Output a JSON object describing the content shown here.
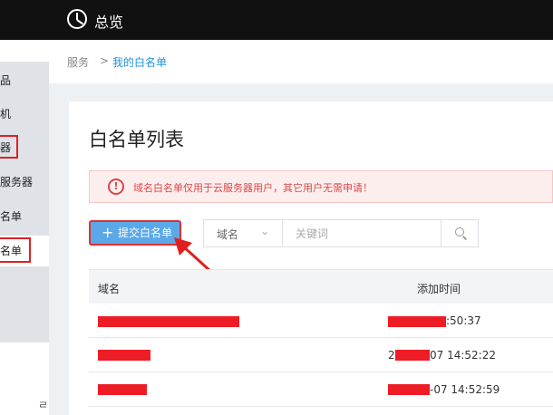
{
  "header": {
    "title": "总览",
    "logo_icon": "dashboard-icon"
  },
  "sidebar": {
    "items": [
      {
        "label": "品",
        "active": false
      },
      {
        "label": "机",
        "active": false
      },
      {
        "label": "器",
        "active": false
      },
      {
        "label": "服务器",
        "active": false
      },
      {
        "label": "名单",
        "active": false
      },
      {
        "label": "名单",
        "active": true
      }
    ],
    "bottom_label": "ㄹ"
  },
  "breadcrumb": {
    "parent": "服务",
    "separator": ">",
    "current": "我的白名单"
  },
  "page": {
    "title": "白名单列表",
    "alert": {
      "icon": "info-icon",
      "text": "域名白名单仅用于云服务器用户，其它用户无需申请！"
    },
    "submit_button": {
      "icon": "plus-icon",
      "label": "提交白名单"
    },
    "filter": {
      "select_value": "域名",
      "search_placeholder": "关键词",
      "search_value": ""
    }
  },
  "table": {
    "columns": [
      "域名",
      "添加时间"
    ],
    "rows": [
      {
        "domain": "",
        "time": ":50:37"
      },
      {
        "domain": "",
        "time": "07 14:52:22"
      },
      {
        "domain": "",
        "time": "-07 14:52:59"
      }
    ]
  },
  "colors": {
    "accent": "#2196d8",
    "button": "#5aa8e8",
    "alert_text": "#d84848",
    "annotation_red": "#e02020"
  }
}
